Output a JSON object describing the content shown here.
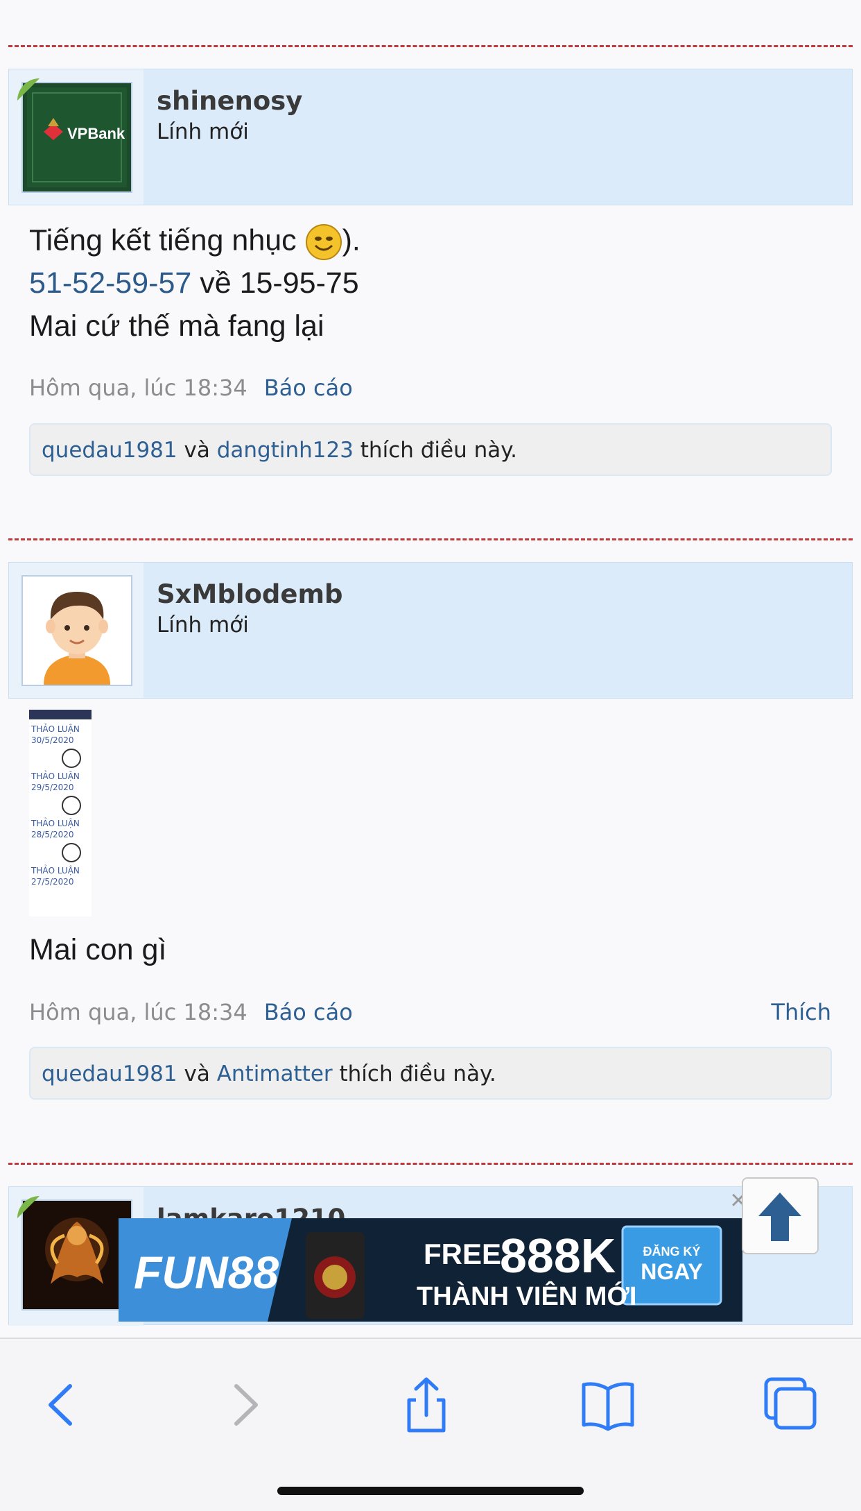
{
  "posts": [
    {
      "username": "shinenosy",
      "user_title": "Lính mới",
      "avatar": "vpbank-logo",
      "avatar_text": "VPBank",
      "line1": "Tiếng kết tiếng nhục ",
      "line1_end": ").",
      "emoji": "smiley-icon",
      "line2_link": "51-52-59-57",
      "line2_rest": " về 15-95-75",
      "line3": "Mai cứ thế mà fang lại",
      "time": "Hôm qua, lúc 18:34",
      "report": "Báo cáo",
      "likers": [
        "quedau1981",
        "dangtinh123"
      ],
      "and": " và ",
      "likes_suffix": " thích điều này."
    },
    {
      "username": "SxMblodemb",
      "user_title": "Lính mới",
      "avatar": "boy-avatar",
      "attachment_lines": [
        "THẢO LUẬN",
        "30/5/2020",
        "THẢO LUẬN",
        "29/5/2020",
        "THẢO LUẬN",
        "28/5/2020",
        "THẢO LUẬN",
        "27/5/2020"
      ],
      "text": "Mai con gì",
      "time": "Hôm qua, lúc 18:34",
      "report": "Báo cáo",
      "like": "Thích",
      "likers": [
        "quedau1981",
        "Antimatter"
      ],
      "and": " và ",
      "likes_suffix": " thích điều này."
    },
    {
      "username": "lamkaro1210",
      "avatar": "fire-warrior-avatar"
    }
  ],
  "ad": {
    "brand": "FUN88",
    "free": "FREE",
    "amount": "888K",
    "subtitle": "THÀNH VIÊN MỚI",
    "cta_line1": "ĐĂNG KÝ",
    "cta_line2": "NGAY",
    "close": "×"
  },
  "colors": {
    "accent": "#2d5f93",
    "header_bg": "#dcebfa",
    "divider": "#c0393b",
    "ios_blue": "#2f7cf6"
  },
  "toolbar": {
    "icons": [
      "back-icon",
      "forward-icon",
      "share-icon",
      "bookmarks-icon",
      "tabs-icon"
    ]
  }
}
